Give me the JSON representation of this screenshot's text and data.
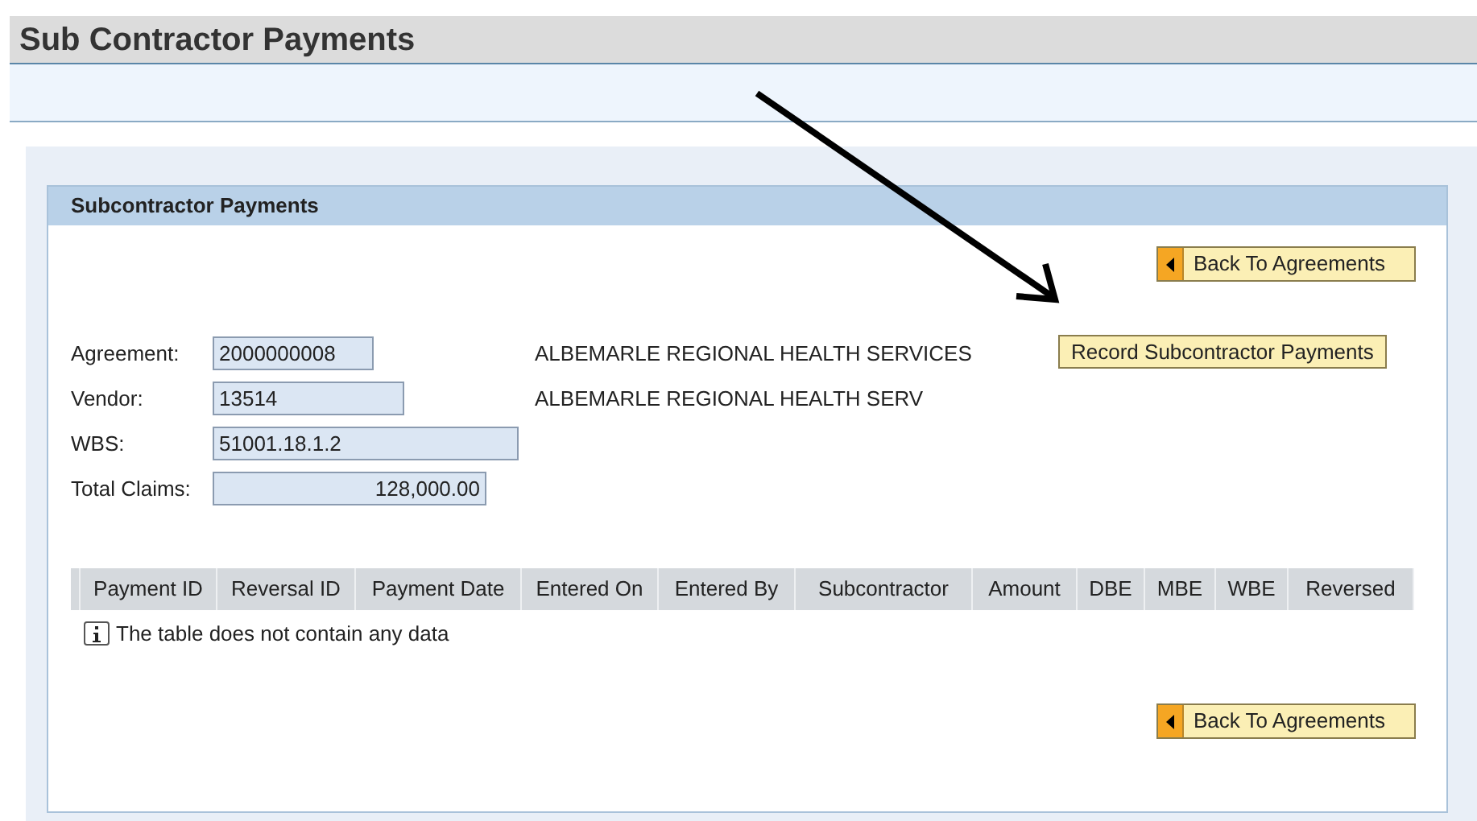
{
  "page_title": "Sub Contractor Payments",
  "panel": {
    "title": "Subcontractor Payments",
    "top_button": "Back To Agreements",
    "fields": [
      {
        "label": "Agreement:",
        "value": "2000000008",
        "kind": "text",
        "description": "ALBEMARLE REGIONAL HEALTH SERVICES"
      },
      {
        "label": "Vendor:",
        "value": "13514",
        "kind": "text",
        "description": "ALBEMARLE REGIONAL HEALTH SERV"
      },
      {
        "label": "WBS:",
        "value": "51001.18.1.2",
        "kind": "text"
      },
      {
        "label": "Total Claims:",
        "value": "128,000.00",
        "kind": "amount"
      }
    ],
    "record_button": "Record Subcontractor Payments",
    "table": {
      "columns": [
        "Payment ID",
        "Reversal ID",
        "Payment Date",
        "Entered On",
        "Entered By",
        "Subcontractor",
        "Amount",
        "DBE",
        "MBE",
        "WBE",
        "Reversed"
      ],
      "empty_message": "The table does not contain any data"
    },
    "bottom_button": "Back To Agreements"
  }
}
